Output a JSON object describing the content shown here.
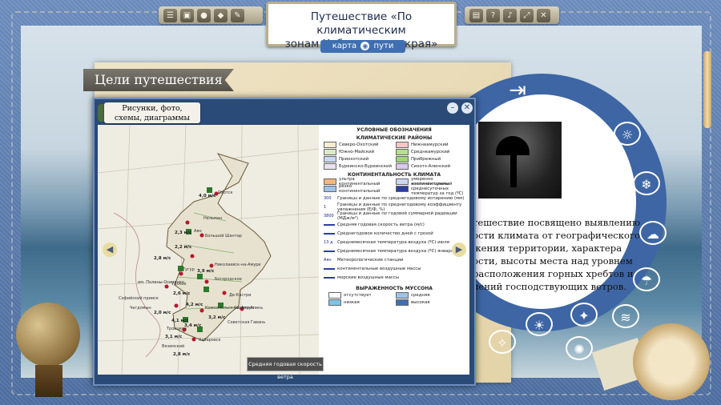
{
  "app": {
    "title_line1": "Путешествие «По климатическим",
    "title_line2": "зонам Хабаровского края»",
    "map_tab_left": "карта",
    "map_tab_right": "пути"
  },
  "goals": {
    "heading": "Цели путешествия"
  },
  "right_panel": {
    "text_lines": [
      "тешествие посвящено выявлению",
      "ости климата от географического",
      "жения территории, характера",
      "ости, высоты места над уровнем",
      "расположения горных хребтов и",
      "лений господствующих ветров."
    ]
  },
  "modal": {
    "label": "Рисунки, фото, схемы, диаграммы",
    "tooltip": "Средняя годовая скорость ветра",
    "map_cities": [
      "Охотск",
      "Аян",
      "Большой Шантар",
      "Николаевск-на-Амуре",
      "Богородское",
      "Де-Кастри",
      "Комсомольск-на-Амуре",
      "Советская Гавань",
      "Хабаровск",
      "Вяземский",
      "Софийский прииск",
      "Троицкое",
      "Чегдомын",
      "Нельман",
      "им. Полины Осипенко",
      "Удское",
      "Тугур",
      "Сихотэ-Алинь"
    ],
    "map_values": [
      "4,0 м/с",
      "2,3 м/с",
      "2,2 м/с",
      "2,8 м/с",
      "3,9 м/с",
      "2,6 м/с",
      "2,0 м/с",
      "4,2 м/с",
      "3,2 м/с",
      "3,4 м/с",
      "3,1 м/с",
      "4,1 м/с",
      "2,8 м/с"
    ],
    "legend": {
      "title": "УСЛОВНЫЕ ОБОЗНАЧЕНИЯ",
      "climate_regions_title": "КЛИМАТИЧЕСКИЕ РАЙОНЫ",
      "climate_regions": [
        {
          "name": "Северо-Охотский",
          "color": "#f5ecd2"
        },
        {
          "name": "Нижнеамурский",
          "color": "#f6c6c6"
        },
        {
          "name": "Южно-Майский",
          "color": "#dce9c7"
        },
        {
          "name": "Среднеамурский",
          "color": "#b6e08a"
        },
        {
          "name": "Приохотский",
          "color": "#c7d9f2"
        },
        {
          "name": "Прибрежный",
          "color": "#9fd67a"
        },
        {
          "name": "Буреинско-Буреинский",
          "color": "#e9e2f0"
        },
        {
          "name": "Сихотэ-Алинский",
          "color": "#d9c9ea"
        }
      ],
      "continentality_title": "КОНТИНЕНТАЛЬНОСТЬ КЛИМАТА",
      "continentality": [
        {
          "name": "ультра континентальный",
          "color": "#f2b77a"
        },
        {
          "name": "умеренно континентальный",
          "color": "#c9d8f0"
        },
        {
          "name": "резко континентальный",
          "color": "#9fc3e8"
        },
        {
          "name": "изолинии суммы среднесуточных температур за год (ºС)",
          "color": "#2a3fa0"
        }
      ],
      "items": [
        "Границы и данные по среднегодовому испарению (мм)",
        "Границы и данные по среднегодовому коэффициенту увлажнения (Е/Ф, %)",
        "Границы и данные по годовой суммарной радиации (МДж/м²)",
        "Средняя годовая скорость ветра (м/с)",
        "Среднегодовое количество дней с грозой",
        "Среднемесячная температура воздуха (ºС) июля",
        "Среднемесячная температура воздуха (ºС) января",
        "Метеорологические станции",
        "континентальные воздушные массы",
        "морские воздушные массы"
      ],
      "item_marks": [
        "300",
        "1",
        "3800",
        "",
        "",
        "13 д",
        "",
        "Аян",
        "",
        ""
      ],
      "monsoon_title": "ВЫРАЖЕННОСТЬ МУССОНА",
      "monsoon": [
        {
          "name": "отсутствует",
          "color": "#ffffff"
        },
        {
          "name": "средняя",
          "color": "#9fc3e8"
        },
        {
          "name": "низкая",
          "color": "#7fc3e6"
        },
        {
          "name": "высокая",
          "color": "#3f6fb0"
        }
      ]
    }
  }
}
